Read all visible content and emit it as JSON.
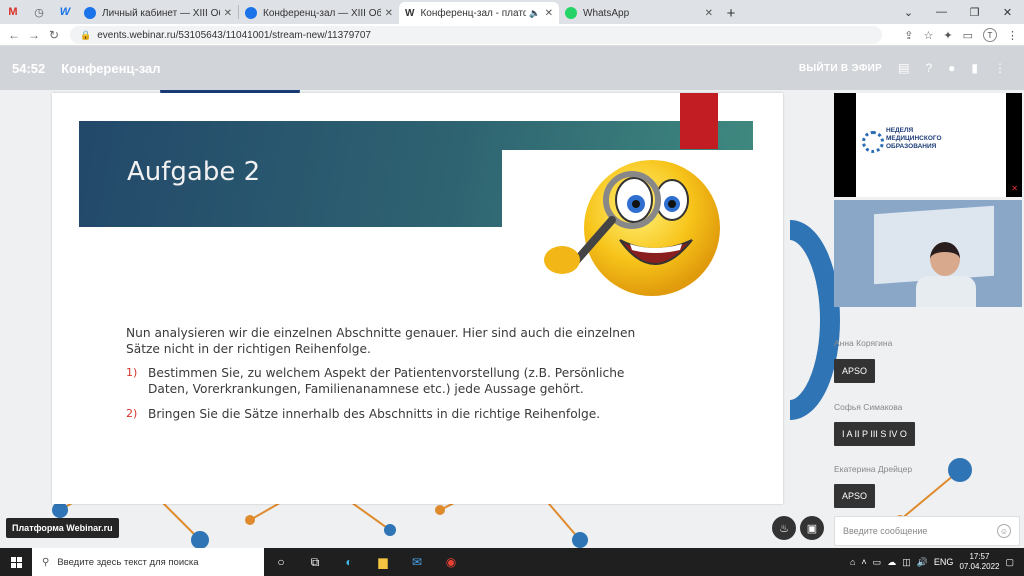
{
  "browser": {
    "tabs": [
      {
        "title": "Личный кабинет — XIII Общеро",
        "favicon": "globe-icon"
      },
      {
        "title": "Конференц-зал — XIII Общеро",
        "favicon": "globe-icon"
      },
      {
        "title": "Конференц-зал - платформ",
        "favicon": "webinar-w-icon",
        "active": true
      },
      {
        "title": "WhatsApp",
        "favicon": "whatsapp-icon"
      }
    ],
    "pinned_tabs": [
      "gmail-icon",
      "history-icon",
      "web-icon"
    ],
    "url": "events.webinar.ru/53105643/11041001/stream-new/11379707",
    "profile_initial": "T"
  },
  "webinar": {
    "timer": "54:52",
    "room_name": "Конференц-зал",
    "go_live": "ВЫЙТИ В ЭФИР"
  },
  "slide": {
    "title": "Aufgabe 2",
    "intro": "Nun analysieren wir die einzelnen Abschnitte genauer. Hier sind auch die einzelnen Sätze nicht in der richtigen Reihenfolge.",
    "items": [
      {
        "num": "1)",
        "text": "Bestimmen Sie, zu welchem Aspekt der Patientenvorstellung (z.B. Persönliche Daten, Vorerkrankungen, Familienanamnese etc.) jede Aussage gehört."
      },
      {
        "num": "2)",
        "text": "Bringen Sie die Sätze innerhalb des Abschnitts in die richtige Reihenfolge."
      }
    ]
  },
  "video": {
    "poster_title_line1": "НЕДЕЛЯ",
    "poster_title_line2": "МЕДИЦИНСКОГО",
    "poster_title_line3": "ОБРАЗОВАНИЯ"
  },
  "participants": [
    {
      "name": "Анна Корягина",
      "badge": "APSO"
    },
    {
      "name": "Софья Симакова",
      "badge": "I A II P III S IV O"
    },
    {
      "name": "Екатерина Дрейцер",
      "badge": "APSO"
    }
  ],
  "footer": {
    "platform": "Платформа Webinar.ru",
    "message_placeholder": "Введите сообщение"
  },
  "taskbar": {
    "search_placeholder": "Введите здесь текст для поиска",
    "lang": "ENG",
    "time": "17:57",
    "date": "07.04.2022"
  },
  "colors": {
    "slide_band": "#2e6371",
    "slide_accent": "#c21d22",
    "list_number": "#d5352c"
  }
}
